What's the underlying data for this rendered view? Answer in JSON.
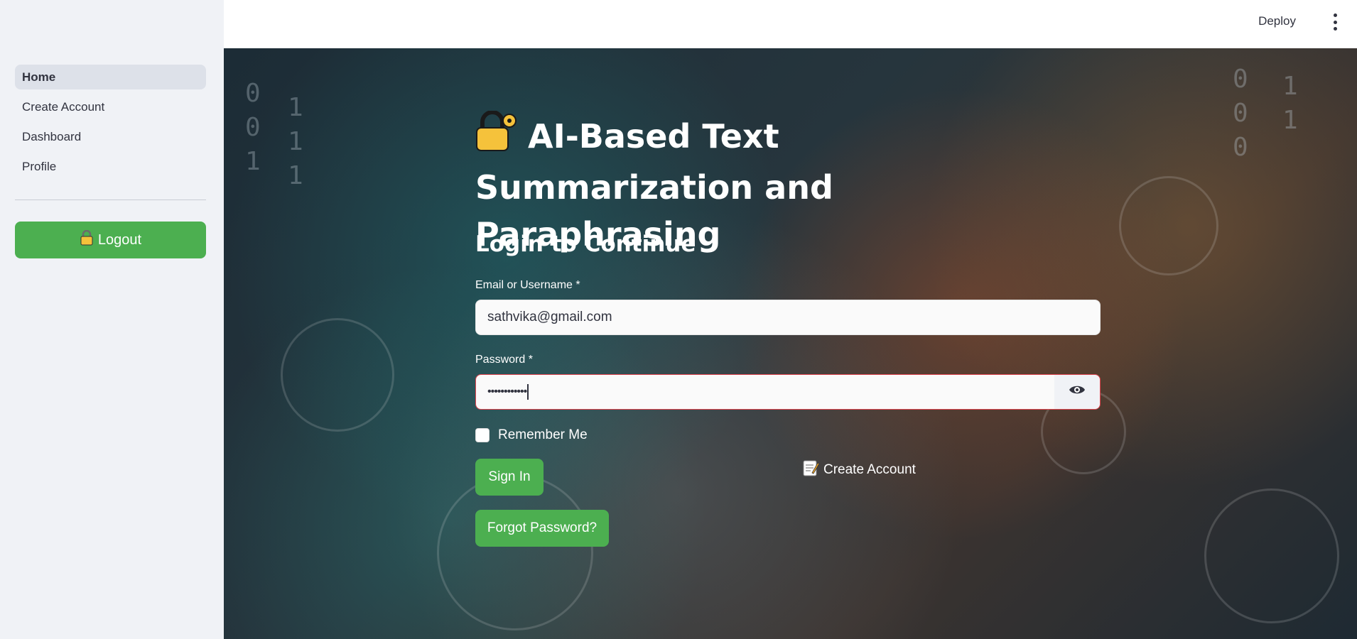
{
  "sidebar": {
    "nav_items": [
      {
        "label": "Home",
        "active": true
      },
      {
        "label": "Create Account",
        "active": false
      },
      {
        "label": "Dashboard",
        "active": false
      },
      {
        "label": "Profile",
        "active": false
      }
    ],
    "logout_label": "Logout",
    "logout_icon": "lock-icon"
  },
  "header": {
    "deploy_label": "Deploy",
    "menu_icon": "kebab-menu-icon"
  },
  "main": {
    "title": "AI-Based Text Summarization and Paraphrasing",
    "title_icon": "lock-with-key-icon",
    "subtitle": "Login to Continue",
    "email": {
      "label": "Email or Username *",
      "value": "sathvika@gmail.com"
    },
    "password": {
      "label": "Password *",
      "masked_value": "••••••••••••"
    },
    "remember_me": {
      "label": "Remember Me",
      "checked": false
    },
    "sign_in_label": "Sign In",
    "create_account_label": "Create Account",
    "create_account_icon": "memo-icon",
    "forgot_password_label": "Forgot Password?"
  },
  "colors": {
    "accent_green": "#4caf50",
    "sidebar_bg": "#f0f2f6",
    "error_border": "#e0454f"
  }
}
